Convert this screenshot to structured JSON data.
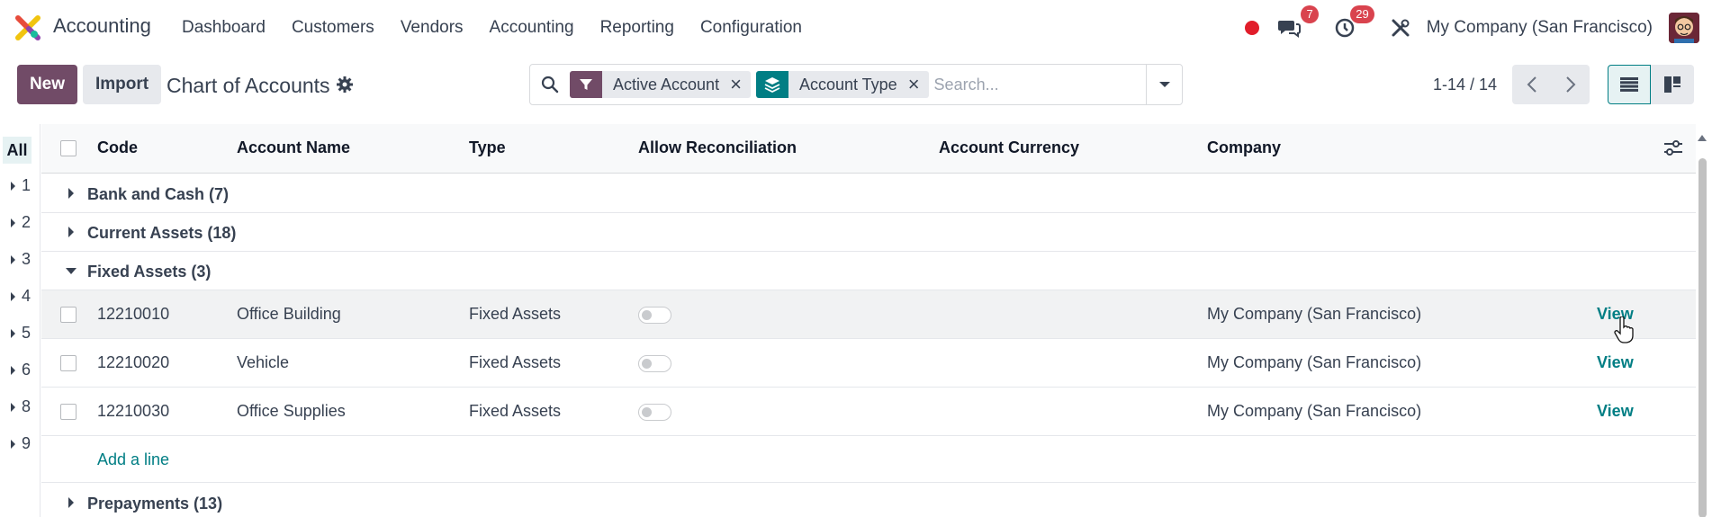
{
  "navbar": {
    "app_name": "Accounting",
    "menu": [
      "Dashboard",
      "Customers",
      "Vendors",
      "Accounting",
      "Reporting",
      "Configuration"
    ],
    "messages_badge": "7",
    "activities_badge": "29",
    "company": "My Company (San Francisco)"
  },
  "control": {
    "new_label": "New",
    "import_label": "Import",
    "title": "Chart of Accounts"
  },
  "search": {
    "facets": [
      {
        "label": "Active Account",
        "icon": "filter-icon",
        "color": "#714b67"
      },
      {
        "label": "Account Type",
        "icon": "layers-icon",
        "color": "#017e84"
      }
    ],
    "placeholder": "Search..."
  },
  "pager": {
    "value": "1-14 / 14"
  },
  "sidepanel": {
    "all_label": "All",
    "items": [
      "1",
      "2",
      "3",
      "4",
      "5",
      "6",
      "8",
      "9"
    ]
  },
  "list": {
    "columns": [
      "Code",
      "Account Name",
      "Type",
      "Allow Reconciliation",
      "Account Currency",
      "Company"
    ],
    "groups": [
      {
        "label": "Bank and Cash (7)",
        "expanded": false
      },
      {
        "label": "Current Assets (18)",
        "expanded": false
      },
      {
        "label": "Fixed Assets (3)",
        "expanded": true
      },
      {
        "label": "Prepayments (13)",
        "expanded": false
      }
    ],
    "rows": [
      {
        "code": "12210010",
        "name": "Office Building",
        "type": "Fixed Assets",
        "reconcile": false,
        "company": "My Company (San Francisco)",
        "action": "View"
      },
      {
        "code": "12210020",
        "name": "Vehicle",
        "type": "Fixed Assets",
        "reconcile": false,
        "company": "My Company (San Francisco)",
        "action": "View"
      },
      {
        "code": "12210030",
        "name": "Office Supplies",
        "type": "Fixed Assets",
        "reconcile": false,
        "company": "My Company (San Francisco)",
        "action": "View"
      }
    ],
    "add_line_label": "Add a line"
  },
  "colors": {
    "primary": "#714b67",
    "accent": "#017e84",
    "badge": "#d9434e",
    "record": "#e11d2a"
  }
}
